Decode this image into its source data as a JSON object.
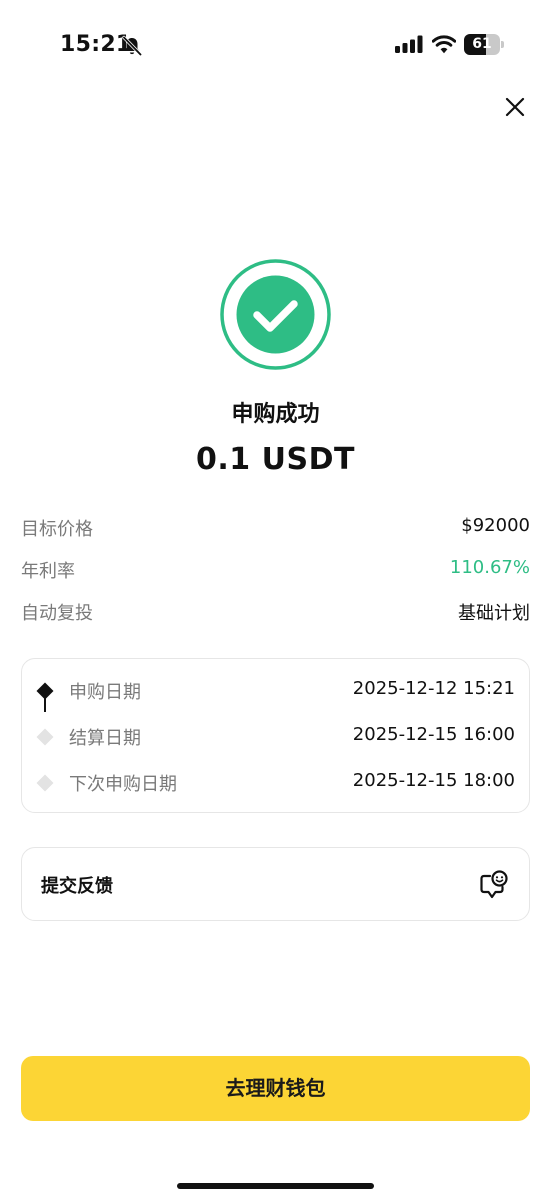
{
  "status_bar": {
    "time": "15:21",
    "battery_level": "61",
    "battery_fraction": 0.61,
    "icons": [
      "bell-slash-icon",
      "cellular-signal-icon",
      "wifi-icon",
      "battery-icon"
    ]
  },
  "header": {
    "close_icon": "close-icon"
  },
  "result": {
    "icon": "check-circle-icon",
    "title": "申购成功",
    "amount": "0.1 USDT"
  },
  "details": [
    {
      "label": "目标价格",
      "value": "$92000",
      "highlight": false
    },
    {
      "label": "年利率",
      "value": "110.67%",
      "highlight": true
    },
    {
      "label": "自动复投",
      "value": "基础计划",
      "highlight": false
    }
  ],
  "timeline": [
    {
      "label": "申购日期",
      "value": "2025-12-12 15:21",
      "active": true
    },
    {
      "label": "结算日期",
      "value": "2025-12-15 16:00",
      "active": false
    },
    {
      "label": "下次申购日期",
      "value": "2025-12-15 18:00",
      "active": false
    }
  ],
  "feedback": {
    "label": "提交反馈",
    "icon": "feedback-chat-icon"
  },
  "cta": {
    "label": "去理财钱包"
  },
  "colors": {
    "accent_yellow": "#fcd535",
    "success_green": "#2ebd85",
    "text_primary": "#111111",
    "text_secondary": "#7a7a7a"
  }
}
